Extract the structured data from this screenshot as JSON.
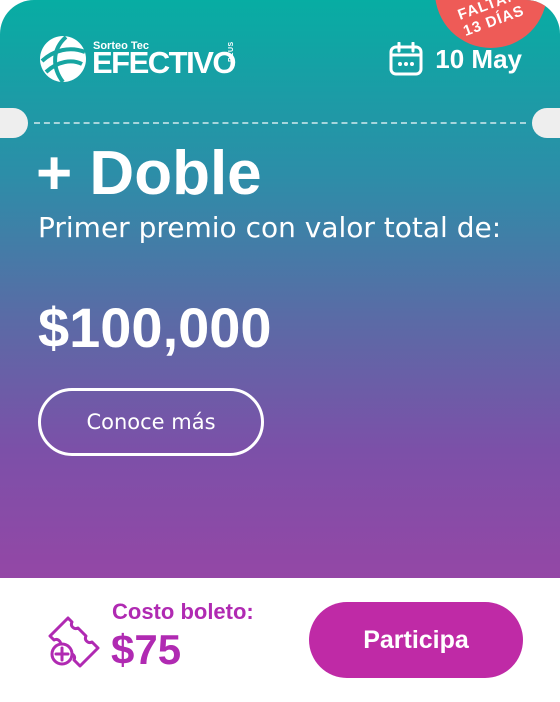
{
  "badge": {
    "line1": "FALTAN",
    "line2": "13 DÍAS"
  },
  "brand": {
    "small": "Sorteo Tec",
    "main": "EFECTIVO",
    "plus": "PLUS"
  },
  "header": {
    "date": "10 May"
  },
  "hero": {
    "headline": "+ Doble",
    "subtitle": "Primer premio con valor total de:",
    "amount": "$100,000",
    "more_label": "Conoce más"
  },
  "footer": {
    "cost_label": "Costo boleto:",
    "cost_value": "$75",
    "cta_label": "Participa"
  },
  "colors": {
    "gradient_top": "#07ada3",
    "gradient_bottom": "#9447a6",
    "badge": "#ee5b57",
    "accent": "#b02ab2",
    "cta": "#bf2aa6"
  },
  "icons": [
    "globe-logo-icon",
    "calendar-icon",
    "ticket-add-icon"
  ]
}
